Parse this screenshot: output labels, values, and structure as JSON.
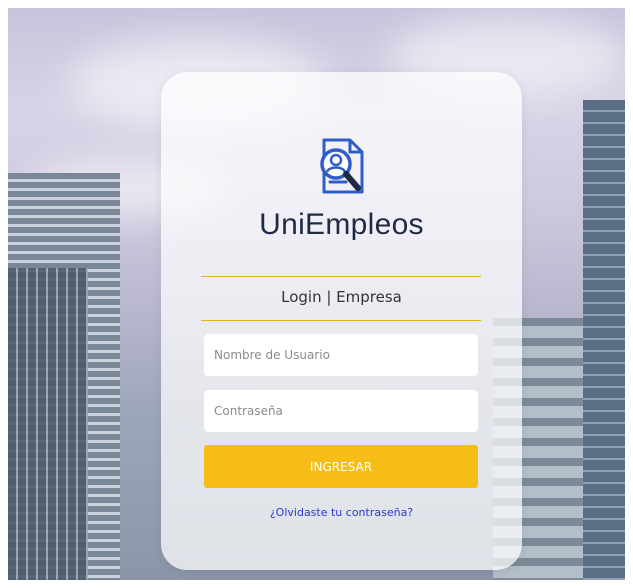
{
  "brand": {
    "name": "UniEmpleos",
    "logo_icon": "search-user-document-icon"
  },
  "login": {
    "subtitle": "Login | Empresa",
    "username_placeholder": "Nombre de Usuario",
    "password_placeholder": "Contraseña",
    "submit_label": "INGRESAR",
    "forgot_link": "¿Olvidaste tu contraseña?"
  },
  "colors": {
    "accent": "#f7bd17",
    "brand_text": "#1f2a44",
    "logo_blue": "#2f5ec8",
    "link": "#2a3ad0"
  }
}
